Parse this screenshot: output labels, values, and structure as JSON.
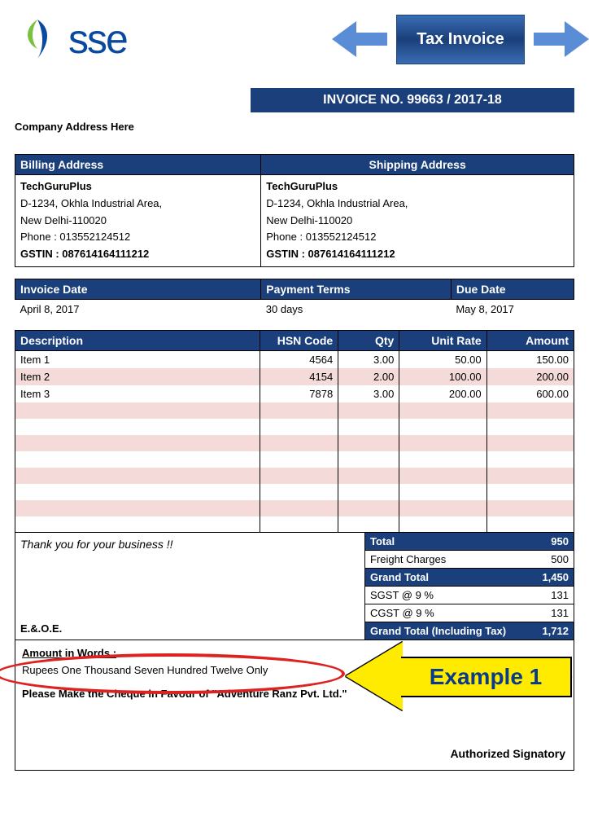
{
  "logo_text": "sse",
  "tax_invoice_label": "Tax Invoice",
  "invoice_no_bar": "INVOICE NO. 99663 / 2017-18",
  "company_address_label": "Company Address Here",
  "billing_head": "Billing Address",
  "shipping_head": "Shipping Address",
  "billing": {
    "name": "TechGuruPlus",
    "line1": "D-1234, Okhla Industrial Area,",
    "line2": "New Delhi-110020",
    "phone": "Phone : 013552124512",
    "gstin": "GSTIN : 087614164111212"
  },
  "shipping": {
    "name": "TechGuruPlus",
    "line1": "D-1234, Okhla Industrial Area,",
    "line2": "New Delhi-110020",
    "phone": "Phone : 013552124512",
    "gstin": "GSTIN : 087614164111212"
  },
  "meta": {
    "invoice_date_label": "Invoice Date",
    "invoice_date": "April 8, 2017",
    "payment_terms_label": "Payment Terms",
    "payment_terms": "30 days",
    "due_date_label": "Due Date",
    "due_date": "May 8, 2017"
  },
  "cols": {
    "desc": "Description",
    "hsn": "HSN Code",
    "qty": "Qty",
    "rate": "Unit Rate",
    "amt": "Amount"
  },
  "items": [
    {
      "desc": "Item 1",
      "hsn": "4564",
      "qty": "3.00",
      "rate": "50.00",
      "amt": "150.00"
    },
    {
      "desc": "Item 2",
      "hsn": "4154",
      "qty": "2.00",
      "rate": "100.00",
      "amt": "200.00"
    },
    {
      "desc": "Item 3",
      "hsn": "7878",
      "qty": "3.00",
      "rate": "200.00",
      "amt": "600.00"
    }
  ],
  "thank_you": "Thank you for your business !!",
  "eoe": "E.&.O.E.",
  "totals": {
    "total_label": "Total",
    "total": "950",
    "freight_label": "Freight Charges",
    "freight": "500",
    "grand_total_label": "Grand Total",
    "grand_total": "1,450",
    "sgst_label": "SGST @ 9 %",
    "sgst": "131",
    "cgst_label": "CGST @ 9 %",
    "cgst": "131",
    "incl_tax_label": "Grand Total (Including Tax)",
    "incl_tax": "1,712"
  },
  "footer": {
    "amt_words_label": "Amount in Words :",
    "amt_words": "Rupees One Thousand Seven Hundred Twelve Only",
    "cheque_line": "Please Make the Cheque in Favour of \"Adventure Ranz Pvt. Ltd.\"",
    "auth_sig": "Authorized Signatory"
  },
  "example_label": "Example 1",
  "pvt_ltd_visible": "t. Ltd."
}
